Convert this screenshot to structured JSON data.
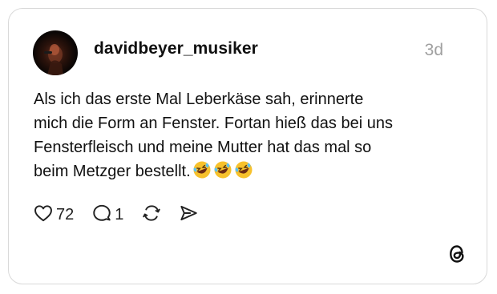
{
  "post": {
    "username": "davidbeyer_musiker",
    "time": "3d",
    "text_lines": [
      "Als ich das erste Mal Leberkäse sah, erinnerte",
      "mich die Form an Fenster. Fortan hieß das bei uns",
      "Fensterfleisch und meine Mutter hat das mal so",
      "beim Metzger bestellt."
    ],
    "emojis": [
      "rolling-on-floor-laughing",
      "rolling-on-floor-laughing",
      "rolling-on-floor-laughing"
    ]
  },
  "actions": {
    "likes": "72",
    "replies": "1",
    "icons": [
      "heart-icon",
      "comment-icon",
      "repost-icon",
      "share-icon"
    ]
  },
  "branding": {
    "logo": "threads-logo"
  }
}
